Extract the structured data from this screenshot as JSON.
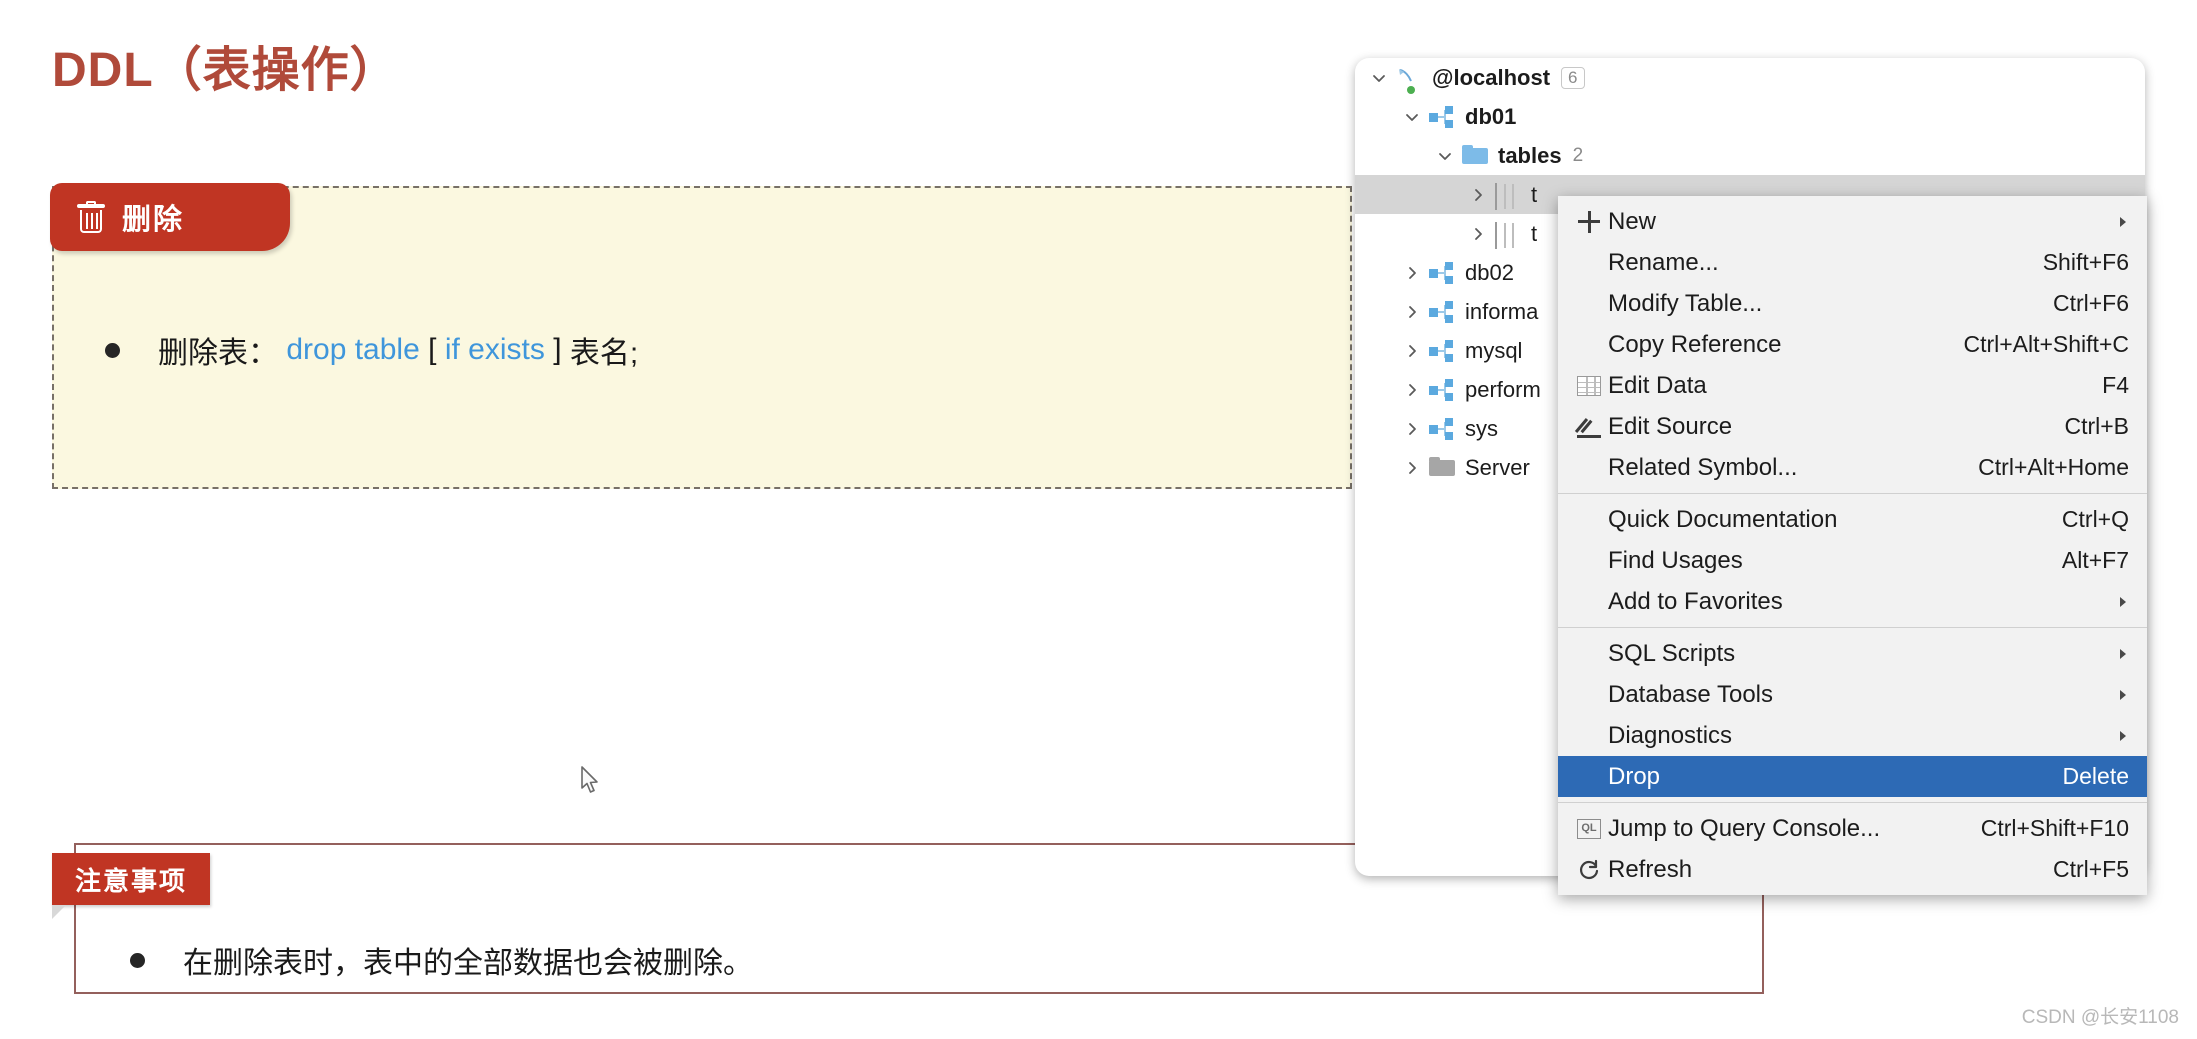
{
  "slide": {
    "title": "DDL（表操作）",
    "watermark": "CSDN @长安1108"
  },
  "syntax_card": {
    "ribbon_label": "删除",
    "ribbon_icon": "trash-icon",
    "bullet": {
      "prefix": "删除表：",
      "keyword": "drop table",
      "bracket_open": "[",
      "optional": "if exists",
      "bracket_close": "]",
      "suffix": "表名;"
    }
  },
  "note_card": {
    "ribbon_label": "注意事项",
    "bullet_text": "在删除表时，表中的全部数据也会被删除。"
  },
  "db_panel": {
    "rows": [
      {
        "label": "@localhost",
        "count": "6",
        "count_style": "badge",
        "icon": "datasource-icon",
        "chevron": "chevron-down-icon",
        "indent": 0,
        "selected": false
      },
      {
        "label": "db01",
        "count": "",
        "count_style": "",
        "icon": "schema-icon",
        "chevron": "chevron-down-icon",
        "indent": 1,
        "selected": false
      },
      {
        "label": "tables",
        "count": "2",
        "count_style": "plain",
        "icon": "folder-icon",
        "chevron": "chevron-down-icon",
        "indent": 2,
        "selected": false
      },
      {
        "label": "t",
        "count": "",
        "count_style": "",
        "icon": "table-icon",
        "chevron": "chevron-right-icon",
        "indent": 3,
        "selected": true
      },
      {
        "label": "t",
        "count": "",
        "count_style": "",
        "icon": "table-icon",
        "chevron": "chevron-right-icon",
        "indent": 3,
        "selected": false
      },
      {
        "label": "db02",
        "count": "",
        "count_style": "",
        "icon": "schema-icon",
        "chevron": "chevron-right-icon",
        "indent": 1,
        "selected": false
      },
      {
        "label": "informa",
        "count": "",
        "count_style": "",
        "icon": "schema-icon",
        "chevron": "chevron-right-icon",
        "indent": 1,
        "selected": false
      },
      {
        "label": "mysql",
        "count": "",
        "count_style": "",
        "icon": "schema-icon",
        "chevron": "chevron-right-icon",
        "indent": 1,
        "selected": false
      },
      {
        "label": "perform",
        "count": "",
        "count_style": "",
        "icon": "schema-icon",
        "chevron": "chevron-right-icon",
        "indent": 1,
        "selected": false
      },
      {
        "label": "sys",
        "count": "",
        "count_style": "",
        "icon": "schema-icon",
        "chevron": "chevron-right-icon",
        "indent": 1,
        "selected": false
      },
      {
        "label": "Server ",
        "count": "",
        "count_style": "",
        "icon": "folder-grey-icon",
        "chevron": "chevron-right-icon",
        "indent": 1,
        "selected": false
      }
    ]
  },
  "context_menu": {
    "highlight_color": "#2d6ab5",
    "items": [
      {
        "type": "item",
        "label": "New",
        "accel": "",
        "icon": "plus-icon",
        "submenu": true,
        "highlighted": false
      },
      {
        "type": "item",
        "label": "Rename...",
        "accel": "Shift+F6",
        "icon": "",
        "submenu": false,
        "highlighted": false
      },
      {
        "type": "item",
        "label": "Modify Table...",
        "accel": "Ctrl+F6",
        "icon": "",
        "submenu": false,
        "highlighted": false
      },
      {
        "type": "item",
        "label": "Copy Reference",
        "accel": "Ctrl+Alt+Shift+C",
        "icon": "",
        "submenu": false,
        "highlighted": false
      },
      {
        "type": "item",
        "label": "Edit Data",
        "accel": "F4",
        "icon": "table-icon",
        "submenu": false,
        "highlighted": false
      },
      {
        "type": "item",
        "label": "Edit Source",
        "accel": "Ctrl+B",
        "icon": "pencil-icon",
        "submenu": false,
        "highlighted": false
      },
      {
        "type": "item",
        "label": "Related Symbol...",
        "accel": "Ctrl+Alt+Home",
        "icon": "",
        "submenu": false,
        "highlighted": false
      },
      {
        "type": "separator"
      },
      {
        "type": "item",
        "label": "Quick Documentation",
        "accel": "Ctrl+Q",
        "icon": "",
        "submenu": false,
        "highlighted": false
      },
      {
        "type": "item",
        "label": "Find Usages",
        "accel": "Alt+F7",
        "icon": "",
        "submenu": false,
        "highlighted": false
      },
      {
        "type": "item",
        "label": "Add to Favorites",
        "accel": "",
        "icon": "",
        "submenu": true,
        "highlighted": false
      },
      {
        "type": "separator"
      },
      {
        "type": "item",
        "label": "SQL Scripts",
        "accel": "",
        "icon": "",
        "submenu": true,
        "highlighted": false
      },
      {
        "type": "item",
        "label": "Database Tools",
        "accel": "",
        "icon": "",
        "submenu": true,
        "highlighted": false
      },
      {
        "type": "item",
        "label": "Diagnostics",
        "accel": "",
        "icon": "",
        "submenu": true,
        "highlighted": false
      },
      {
        "type": "item",
        "label": "Drop",
        "accel": "Delete",
        "icon": "",
        "submenu": false,
        "highlighted": true
      },
      {
        "type": "separator"
      },
      {
        "type": "item",
        "label": "Jump to Query Console...",
        "accel": "Ctrl+Shift+F10",
        "icon": "ql-icon",
        "submenu": false,
        "highlighted": false
      },
      {
        "type": "item",
        "label": "Refresh",
        "accel": "Ctrl+F5",
        "icon": "refresh-icon",
        "submenu": false,
        "highlighted": false
      }
    ]
  }
}
